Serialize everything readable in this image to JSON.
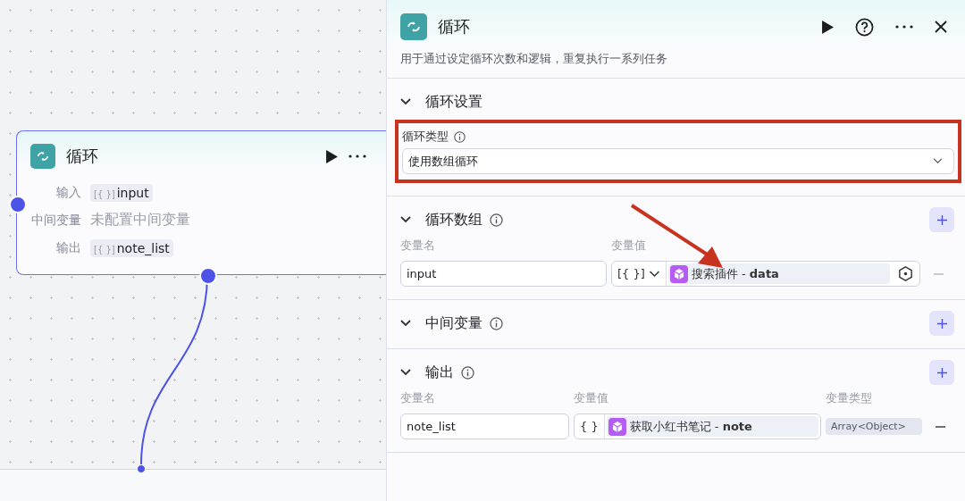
{
  "node": {
    "title": "循环",
    "rows": [
      {
        "label": "输入",
        "kind": "tag",
        "symbol": "[{ }]",
        "value": "input"
      },
      {
        "label": "中间变量",
        "kind": "text",
        "value": "未配置中间变量"
      },
      {
        "label": "输出",
        "kind": "tag",
        "symbol": "[{ }]",
        "value": "note_list"
      }
    ]
  },
  "panel": {
    "title": "循环",
    "description": "用于通过设定循环次数和逻辑，重复执行一系列任务",
    "sections": [
      {
        "title": "循环设置",
        "expanded": true,
        "info": false,
        "add": false,
        "highlighted": true,
        "field": {
          "label": "循环类型",
          "info": true,
          "value": "使用数组循环"
        }
      },
      {
        "title": "循环数组",
        "expanded": true,
        "info": true,
        "add": true,
        "columns": [
          "变量名",
          "变量值"
        ],
        "rows": [
          {
            "name": "input",
            "symbol": "[{ }]",
            "caret": true,
            "value": "搜索插件 - **data**",
            "picker": true
          }
        ]
      },
      {
        "title": "中间变量",
        "expanded": true,
        "info": true,
        "add": true
      },
      {
        "title": "输出",
        "expanded": true,
        "info": true,
        "add": true,
        "columns": [
          "变量名",
          "变量值",
          "变量类型"
        ],
        "rows": [
          {
            "name": "note_list",
            "symbol": "{ }",
            "caret": false,
            "value": "获取小红书笔记 - **note**",
            "picker": false,
            "type": "Array<Object>"
          }
        ]
      }
    ]
  }
}
